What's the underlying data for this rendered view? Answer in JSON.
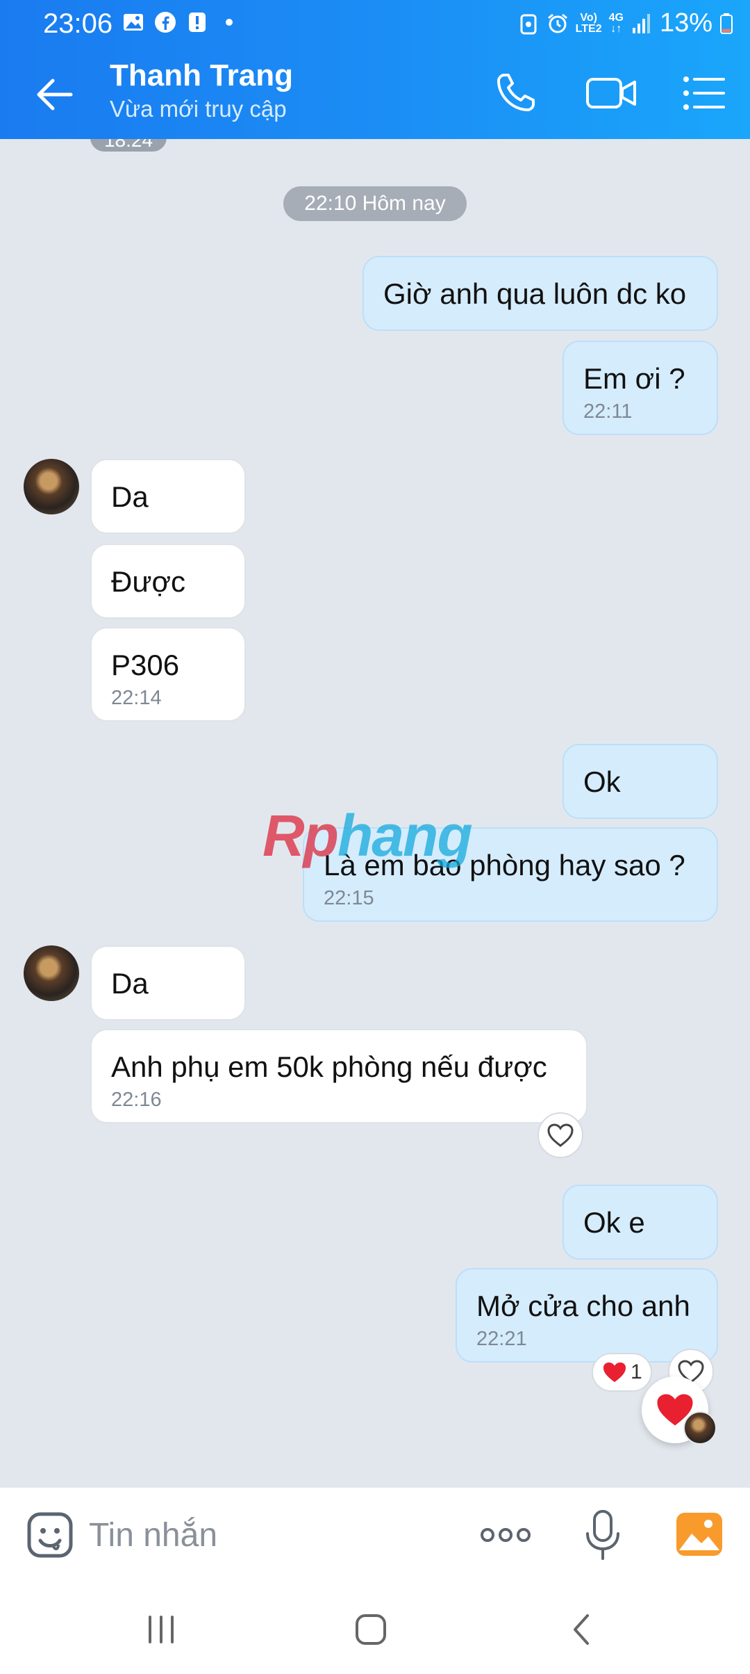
{
  "status_bar": {
    "time": "23:06",
    "battery": "13%",
    "network_top": "Vo)",
    "network_bottom": "LTE2",
    "net_gen": "4G"
  },
  "header": {
    "contact_name": "Thanh Trang",
    "contact_status": "Vừa mới truy cập"
  },
  "chat": {
    "old_time": "18:24",
    "time_divider": "22:10 Hôm nay",
    "messages": [
      {
        "text": "Giờ anh qua luôn dc ko",
        "time": ""
      },
      {
        "text": "Em ơi ?",
        "time": "22:11"
      },
      {
        "text": "Da",
        "time": ""
      },
      {
        "text": "Được",
        "time": ""
      },
      {
        "text": "P306",
        "time": "22:14"
      },
      {
        "text": "Ok",
        "time": ""
      },
      {
        "text": "Là em bao phòng hay sao ?",
        "time": "22:15"
      },
      {
        "text": "Da",
        "time": ""
      },
      {
        "text": "Anh phụ em 50k phòng nếu được",
        "time": "22:16"
      },
      {
        "text": "Ok e",
        "time": ""
      },
      {
        "text": "Mở cửa cho anh",
        "time": "22:21"
      }
    ],
    "reaction_count": "1"
  },
  "watermark": {
    "part1": "Rp",
    "part2": "hang"
  },
  "input": {
    "placeholder": "Tin nhắn"
  },
  "colors": {
    "header_start": "#1a7bf0",
    "header_end": "#1aa6fb",
    "outgoing_bubble": "#d5ecfd",
    "incoming_bubble": "#ffffff",
    "heart": "#e8202f"
  }
}
